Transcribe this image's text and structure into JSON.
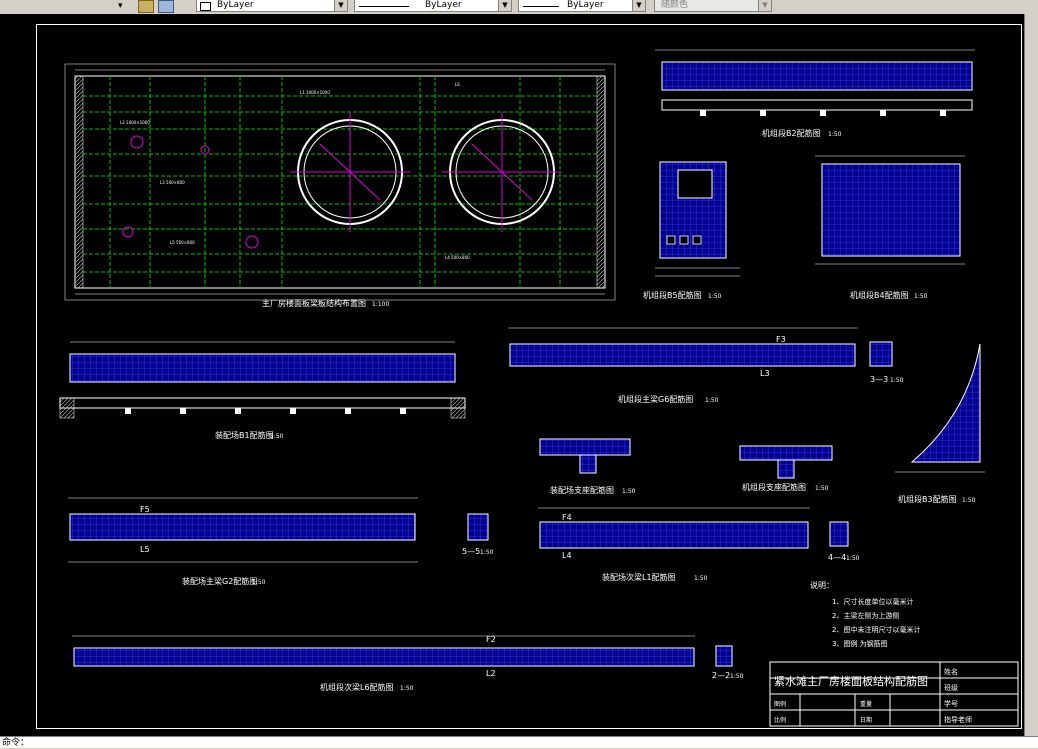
{
  "toolbar": {
    "layer_linetype_label": "ByLayer",
    "linetype_label": "ByLayer",
    "lineweight_label": "ByLayer",
    "color_label": "随颜色"
  },
  "drawing": {
    "titles": {
      "plan": "主厂房楼面板梁板结构布置图",
      "plan_scale": "1:100",
      "b2": "机组段B2配筋图",
      "b2_scale": "1:50",
      "b5": "机组段B5配筋图",
      "b5_scale": "1:50",
      "b4": "机组段B4配筋图",
      "b4_scale": "1:50",
      "b1": "装配场B1配筋图",
      "b1_scale": "1:50",
      "g6": "机组段主梁G6配筋图",
      "g6_scale": "1:50",
      "sec33": "3—3",
      "sec33_scale": "1:50",
      "zzl": "装配场支座配筋图",
      "zzl_scale": "1:50",
      "jzl": "机组段支座配筋图",
      "jzl_scale": "1:50",
      "b3": "机组段B3配筋图",
      "b3_scale": "1:50",
      "g2": "装配场主梁G2配筋图",
      "g2_scale": "1:50",
      "sec55": "5—5",
      "sec55_scale": "1:50",
      "l1": "装配场次梁L1配筋图",
      "l1_scale": "1:50",
      "sec44": "4—4",
      "sec44_scale": "1:50",
      "l6": "机组段次梁L6配筋图",
      "l6_scale": "1:50",
      "sec22": "2—2",
      "sec22_scale": "1:50"
    },
    "beam_labels": {
      "f5": "F5",
      "l5": "L5",
      "f4": "F4",
      "l4": "L4",
      "f3": "F3",
      "l3": "L3",
      "f2": "F2",
      "l2": "L2"
    },
    "notes": {
      "heading": "说明：",
      "items": [
        "1、尺寸长度单位以毫米计",
        "2、主梁左侧为上游侧",
        "2、图中未注明尺寸以毫米计",
        "3、图例         为钢筋图"
      ]
    },
    "title_block": {
      "project": "紧水滩主厂房楼面板结构配筋图",
      "name_label": "姓名",
      "class_label": "班级",
      "id_label": "学号",
      "drawing_label": "图例",
      "scale_label": "比例",
      "weight_label": "重量",
      "date_label": "日期",
      "advisor_label": "指导老师"
    }
  },
  "command_line": {
    "text": "命令："
  }
}
